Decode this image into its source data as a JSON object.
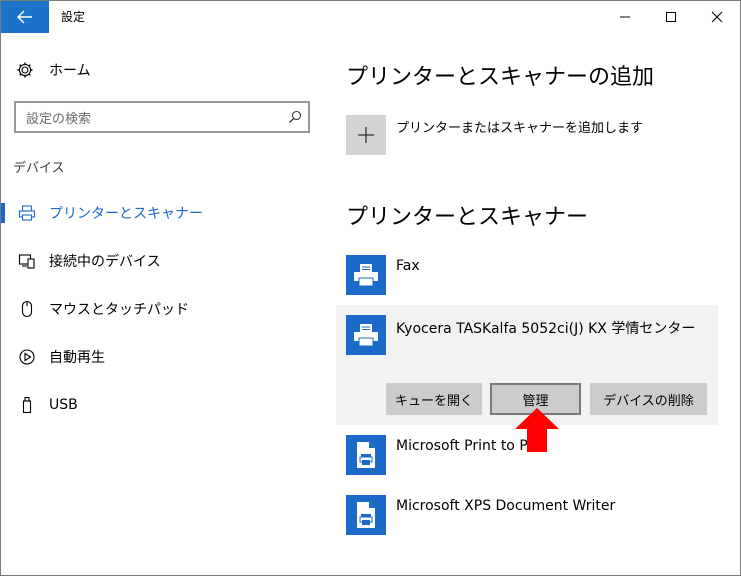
{
  "window": {
    "title": "設定"
  },
  "sidebar": {
    "home_label": "ホーム",
    "search_placeholder": "設定の検索",
    "section_label": "デバイス",
    "items": [
      {
        "label": "プリンターとスキャナー",
        "icon": "printer-icon",
        "active": true
      },
      {
        "label": "接続中のデバイス",
        "icon": "connected-devices-icon",
        "active": false
      },
      {
        "label": "マウスとタッチパッド",
        "icon": "mouse-icon",
        "active": false
      },
      {
        "label": "自動再生",
        "icon": "autoplay-icon",
        "active": false
      },
      {
        "label": "USB",
        "icon": "usb-icon",
        "active": false
      }
    ]
  },
  "main": {
    "add_heading": "プリンターとスキャナーの追加",
    "add_label": "プリンターまたはスキャナーを追加します",
    "list_heading": "プリンターとスキャナー",
    "printers": [
      {
        "name": "Fax"
      },
      {
        "name": "Kyocera TASKalfa 5052ci(J) KX 学情センター"
      },
      {
        "name": "Microsoft Print to PDF"
      },
      {
        "name": "Microsoft XPS Document Writer"
      }
    ],
    "buttons": {
      "open_queue": "キューを開く",
      "manage": "管理",
      "remove_device": "デバイスの削除"
    }
  },
  "colors": {
    "accent": "#1b6ac9",
    "arrow": "#ff0000"
  }
}
